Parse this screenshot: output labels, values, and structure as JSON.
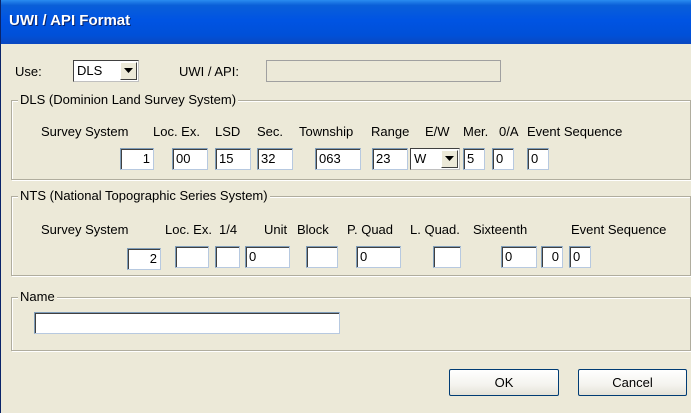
{
  "window": {
    "title": "UWI / API Format"
  },
  "top": {
    "use_label": "Use:",
    "use_value": "DLS",
    "uwi_label": "UWI / API:",
    "uwi_value": ""
  },
  "dls": {
    "title": "DLS (Dominion Land Survey System)",
    "headers": [
      "Survey System",
      "Loc. Ex.",
      "LSD",
      "Sec.",
      "Township",
      "Range",
      "E/W",
      "Mer.",
      "0/A",
      "Event Sequence"
    ],
    "values": {
      "survey_system": "1",
      "loc_ex": "00",
      "lsd": "15",
      "sec": "32",
      "township": "063",
      "range": "23",
      "ew": "W",
      "mer": "5",
      "oa": "0",
      "event_sequence": "0"
    }
  },
  "nts": {
    "title": "NTS (National Topographic Series System)",
    "headers": [
      "Survey System",
      "Loc. Ex.",
      "1/4",
      "Unit",
      "Block",
      "P. Quad",
      "L. Quad.",
      "Sixteenth",
      "Event Sequence"
    ],
    "values": {
      "survey_system": "2",
      "loc_ex": "",
      "quarter": "",
      "unit": "0",
      "block": "",
      "p_quad": "0",
      "l_quad": "",
      "sixteenth": "0",
      "sixteenth_b": "0",
      "event_sequence": "0"
    }
  },
  "name_group": {
    "title": "Name",
    "value": ""
  },
  "buttons": {
    "ok": "OK",
    "cancel": "Cancel"
  },
  "icons": {
    "dropdown": "chevron-down-icon"
  }
}
